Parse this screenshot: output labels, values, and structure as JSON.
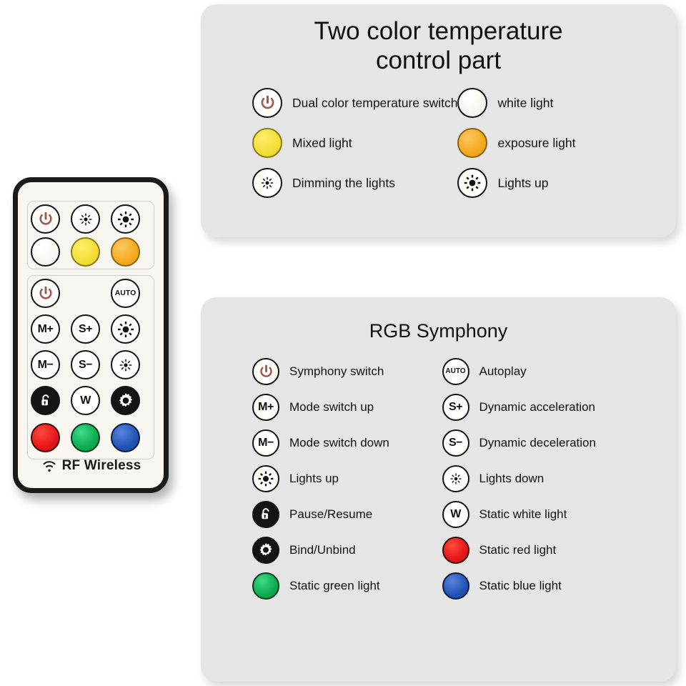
{
  "background_color": "#ffffff",
  "remote": {
    "name": "RF Wireless remote control",
    "brand_label": "RF Wireless",
    "body_color": "#f7f6f1",
    "border_color": "#1b1b1b",
    "cct_section": {
      "name": "two-color-temperature-section",
      "keys": [
        {
          "id": "cct-power",
          "icon": "power-icon",
          "label": "",
          "fill": "white"
        },
        {
          "id": "cct-dim",
          "icon": "brightness-down-icon",
          "label": "",
          "fill": "white"
        },
        {
          "id": "cct-bright",
          "icon": "brightness-up-icon",
          "label": "",
          "fill": "white"
        },
        {
          "id": "cct-white",
          "icon": "color-swatch-icon",
          "label": "",
          "fill": "white"
        },
        {
          "id": "cct-mixed",
          "icon": "color-swatch-icon",
          "label": "",
          "fill": "yellow"
        },
        {
          "id": "cct-exposure",
          "icon": "color-swatch-icon",
          "label": "",
          "fill": "amber"
        }
      ]
    },
    "rgb_section": {
      "name": "rgb-symphony-section",
      "keys": [
        {
          "id": "rgb-power",
          "icon": "power-icon",
          "label": ""
        },
        {
          "id": "rgb-auto",
          "icon": "auto-icon",
          "label": "AUTO"
        },
        {
          "id": "rgb-mplus",
          "icon": "text-icon",
          "label": "M+"
        },
        {
          "id": "rgb-splus",
          "icon": "text-icon",
          "label": "S+"
        },
        {
          "id": "rgb-up",
          "icon": "brightness-up-icon",
          "label": ""
        },
        {
          "id": "rgb-mminus",
          "icon": "text-icon",
          "label": "M−"
        },
        {
          "id": "rgb-sminus",
          "icon": "text-icon",
          "label": "S−"
        },
        {
          "id": "rgb-down",
          "icon": "brightness-down-icon",
          "label": ""
        },
        {
          "id": "rgb-lock",
          "icon": "unlock-icon",
          "label": ""
        },
        {
          "id": "rgb-w",
          "icon": "text-icon",
          "label": "W"
        },
        {
          "id": "rgb-gear",
          "icon": "gear-icon",
          "label": ""
        },
        {
          "id": "rgb-red",
          "icon": "color-swatch-icon",
          "label": "",
          "fill": "red"
        },
        {
          "id": "rgb-green",
          "icon": "color-swatch-icon",
          "label": "",
          "fill": "green"
        },
        {
          "id": "rgb-blue",
          "icon": "color-swatch-icon",
          "label": "",
          "fill": "blue"
        }
      ]
    }
  },
  "panel_cct": {
    "title_line1": "Two color temperature",
    "title_line2": "control part",
    "panel_color": "#e5e5e5",
    "items": [
      {
        "icon": "power-icon",
        "label": "Dual color temperature switch"
      },
      {
        "icon": "color-swatch-icon",
        "label": "white light"
      },
      {
        "icon": "color-swatch-icon",
        "label": "Mixed light"
      },
      {
        "icon": "color-swatch-icon",
        "label": "exposure light"
      },
      {
        "icon": "brightness-down-icon",
        "label": "Dimming the lights"
      },
      {
        "icon": "brightness-up-icon",
        "label": "Lights up"
      }
    ]
  },
  "panel_rgb": {
    "title": "RGB Symphony",
    "panel_color": "#e5e5e5",
    "items": [
      {
        "icon": "power-icon",
        "label": "Symphony switch"
      },
      {
        "icon": "auto-icon",
        "label": "Autoplay",
        "key": "AUTO"
      },
      {
        "icon": "text-icon",
        "label": "Mode switch up",
        "key": "M+"
      },
      {
        "icon": "text-icon",
        "label": "Dynamic acceleration",
        "key": "S+"
      },
      {
        "icon": "text-icon",
        "label": "Mode switch down",
        "key": "M−"
      },
      {
        "icon": "text-icon",
        "label": "Dynamic deceleration",
        "key": "S−"
      },
      {
        "icon": "brightness-up-icon",
        "label": "Lights up"
      },
      {
        "icon": "brightness-down-icon",
        "label": "Lights down"
      },
      {
        "icon": "unlock-icon",
        "label": "Pause/Resume"
      },
      {
        "icon": "text-icon",
        "label": "Static white light",
        "key": "W"
      },
      {
        "icon": "gear-icon",
        "label": "Bind/Unbind"
      },
      {
        "icon": "color-swatch-icon",
        "label": "Static red light"
      },
      {
        "icon": "color-swatch-icon",
        "label": "Static green light"
      },
      {
        "icon": "color-swatch-icon",
        "label": "Static blue light"
      }
    ]
  },
  "colors": {
    "power_icon": "#9c5a52",
    "white": "#fdfdfa",
    "mixed_yellow": "#f4e03a",
    "exposure_amber": "#f6ac22",
    "red": "#e8171a",
    "green": "#0fae53",
    "blue": "#2255b8",
    "black": "#141414",
    "panel_gray": "#e5e5e5",
    "text": "#121212"
  }
}
